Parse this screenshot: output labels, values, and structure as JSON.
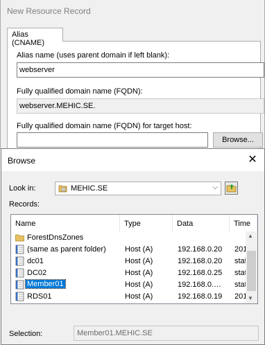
{
  "new_resource_record": {
    "title": "New Resource Record",
    "tab_label": "Alias (CNAME)",
    "alias_label": "Alias name (uses parent domain if left blank):",
    "alias_value": "webserver",
    "fqdn_label": "Fully qualified domain name (FQDN):",
    "fqdn_value": "webserver.MEHIC.SE.",
    "target_label": "Fully qualified domain name (FQDN) for target host:",
    "target_value": "",
    "browse_button": "Browse..."
  },
  "browse": {
    "title": "Browse",
    "close_glyph": "✕",
    "look_in_label": "Look in:",
    "look_in_value": "MEHIC.SE",
    "records_label": "Records:",
    "columns": [
      "Name",
      "Type",
      "Data",
      "Time"
    ],
    "rows": [
      {
        "icon": "folder-icon",
        "name": "ForestDnsZones",
        "type": "",
        "data": "",
        "time": "",
        "selected": false
      },
      {
        "icon": "record-icon",
        "name": "(same as parent folder)",
        "type": "Host (A)",
        "data": "192.168.0.20",
        "time": "201",
        "selected": false
      },
      {
        "icon": "record-icon",
        "name": "dc01",
        "type": "Host (A)",
        "data": "192.168.0.20",
        "time": "stat",
        "selected": false
      },
      {
        "icon": "record-icon",
        "name": "DC02",
        "type": "Host (A)",
        "data": "192.168.0.25",
        "time": "stat",
        "selected": false
      },
      {
        "icon": "record-icon",
        "name": "Member01",
        "type": "Host (A)",
        "data": "192.168.0.…",
        "time": "stat",
        "selected": true
      },
      {
        "icon": "record-icon",
        "name": "RDS01",
        "type": "Host (A)",
        "data": "192.168.0.19",
        "time": "201",
        "selected": false
      }
    ],
    "selection_label": "Selection:",
    "selection_value": "Member01.MEHIC.SE"
  }
}
